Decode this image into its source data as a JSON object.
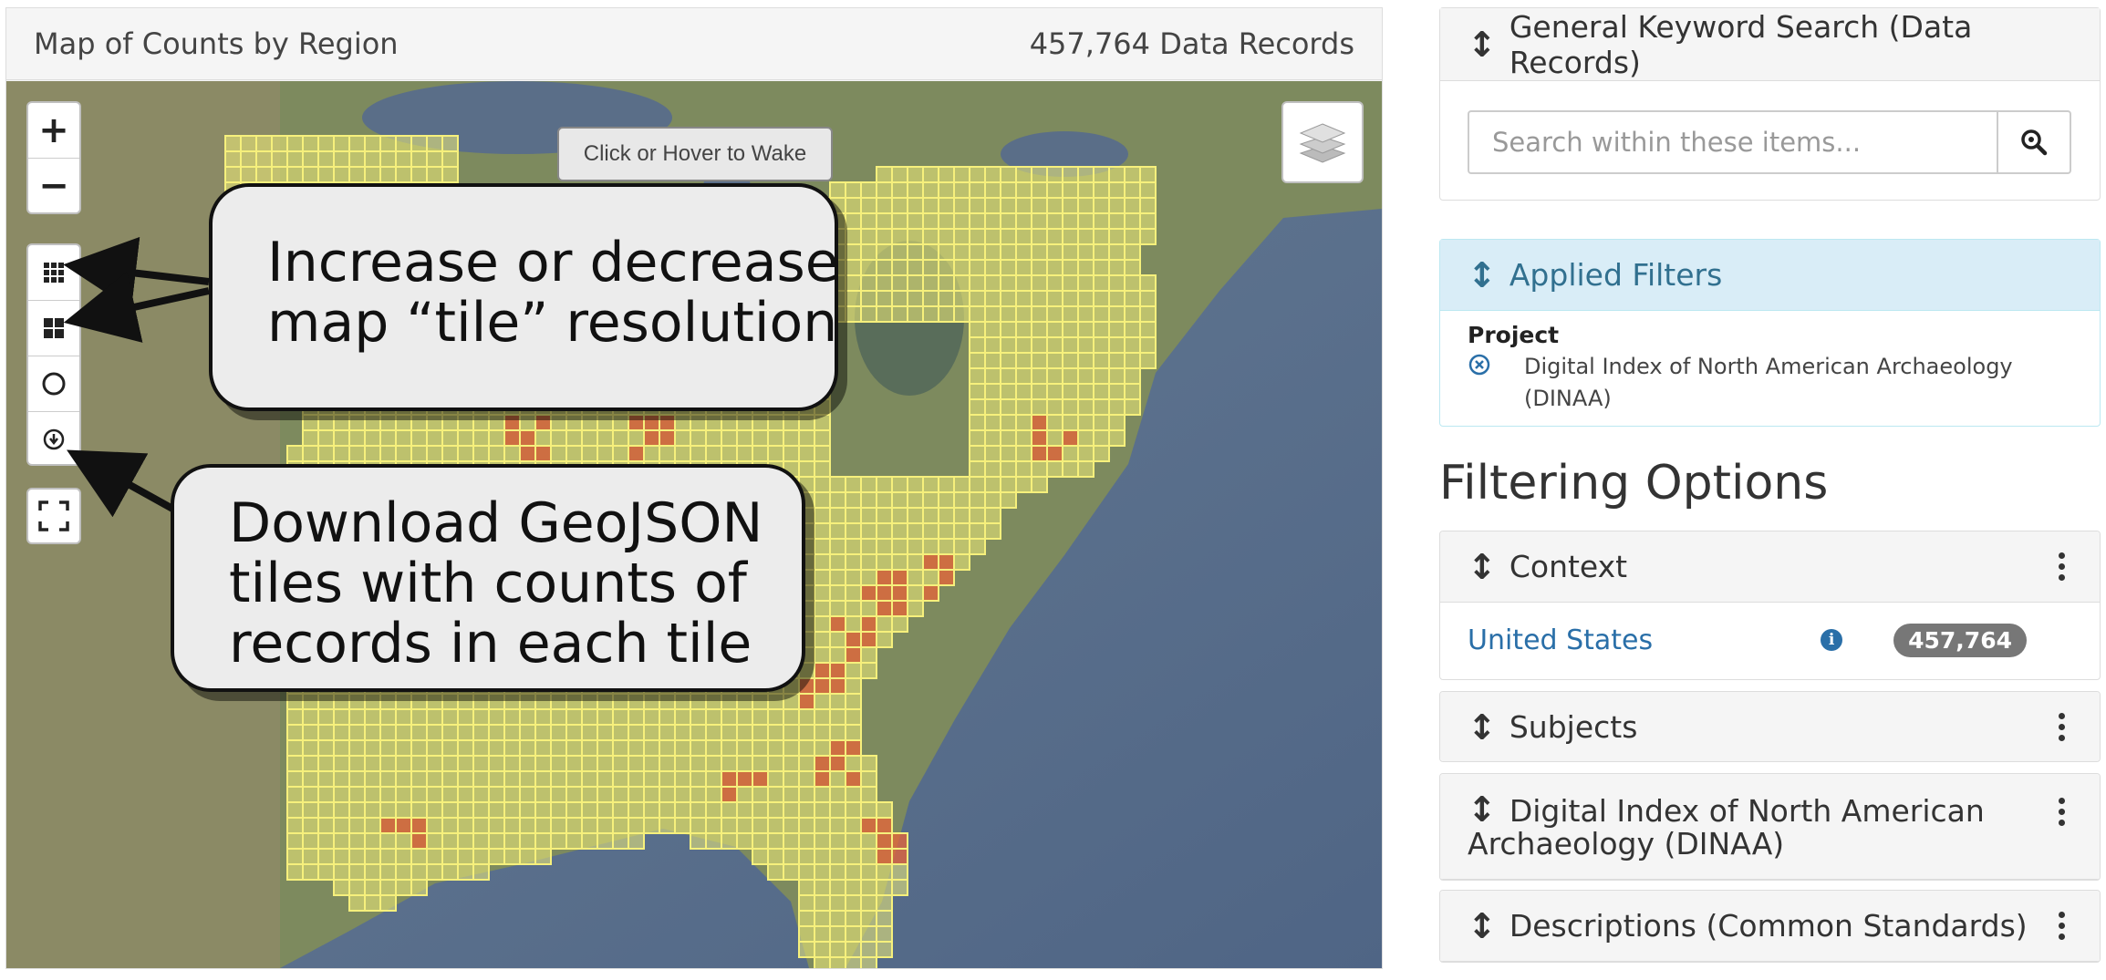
{
  "map": {
    "title": "Map of Counts by Region",
    "record_count": "457,764 Data Records",
    "zoom_in": "+",
    "zoom_out": "−",
    "wake_button": "Click or Hover to Wake",
    "controls": [
      "increase-tile-resolution",
      "decrease-tile-resolution",
      "draw-circle",
      "download-geojson",
      "fullscreen",
      "layers"
    ]
  },
  "callouts": {
    "tile_resolution": [
      "Increase or decrease",
      "map “tile” resolution"
    ],
    "download": [
      "Download GeoJSON",
      "tiles with counts of",
      "records in each tile"
    ]
  },
  "search": {
    "title": "General Keyword Search (Data Records)",
    "placeholder": "Search within these items..."
  },
  "applied_filters": {
    "title": "Applied Filters",
    "label": "Project",
    "value": "Digital Index of North American Archaeology (DINAA)"
  },
  "filtering_options": {
    "title": "Filtering Options",
    "facets": [
      {
        "title": "Context",
        "items": [
          {
            "label": "United States",
            "count": "457,764"
          }
        ]
      },
      {
        "title": "Subjects"
      },
      {
        "title": "Digital Index of North American Archaeology (DINAA)"
      },
      {
        "title": "Descriptions (Common Standards)"
      }
    ]
  },
  "colors": {
    "tile_fill": "#f2ee7a",
    "tile_hot": "#e8643a",
    "link": "#2a6fa8",
    "filter_head": "#d9edf7"
  }
}
